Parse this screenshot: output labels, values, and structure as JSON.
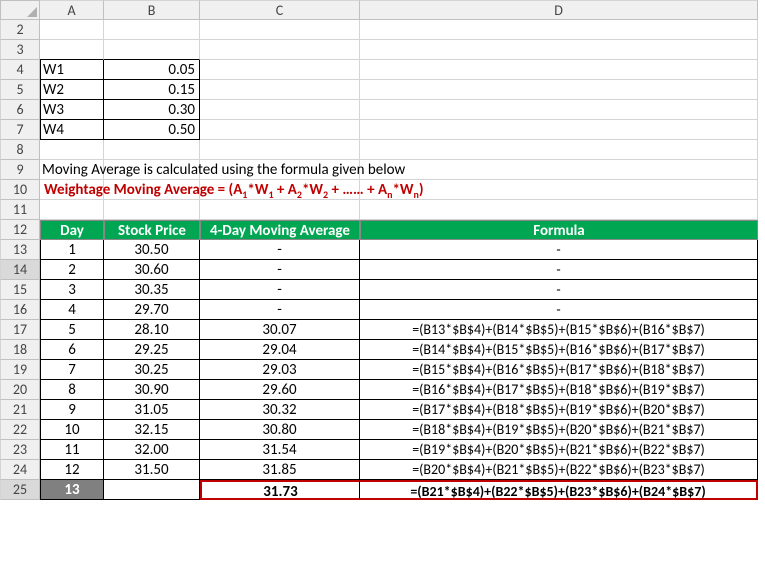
{
  "columns": [
    "",
    "A",
    "B",
    "C",
    "D"
  ],
  "weights": {
    "r4": {
      "label": "W1",
      "val": "0.05"
    },
    "r5": {
      "label": "W2",
      "val": "0.15"
    },
    "r6": {
      "label": "W3",
      "val": "0.30"
    },
    "r7": {
      "label": "W4",
      "val": "0.50"
    }
  },
  "desc_line": "Moving Average is calculated using the formula given below",
  "formula_label_pre": "Weightage Moving Average = (A",
  "formula_label": "Weightage Moving Average = (A₁*W₁ + A₂*W₂ + …… + Aₙ*Wₙ)",
  "headers": {
    "day": "Day",
    "price": "Stock Price",
    "ma": "4-Day Moving Average",
    "formula": "Formula"
  },
  "rows": [
    {
      "rn": "13",
      "day": "1",
      "price": "30.50",
      "ma": "-",
      "formula": "-"
    },
    {
      "rn": "14",
      "day": "2",
      "price": "30.60",
      "ma": "-",
      "formula": "-"
    },
    {
      "rn": "15",
      "day": "3",
      "price": "30.35",
      "ma": "-",
      "formula": "-"
    },
    {
      "rn": "16",
      "day": "4",
      "price": "29.70",
      "ma": "-",
      "formula": "-"
    },
    {
      "rn": "17",
      "day": "5",
      "price": "28.10",
      "ma": "30.07",
      "formula": "=(B13*$B$4)+(B14*$B$5)+(B15*$B$6)+(B16*$B$7)"
    },
    {
      "rn": "18",
      "day": "6",
      "price": "29.25",
      "ma": "29.04",
      "formula": "=(B14*$B$4)+(B15*$B$5)+(B16*$B$6)+(B17*$B$7)"
    },
    {
      "rn": "19",
      "day": "7",
      "price": "30.25",
      "ma": "29.03",
      "formula": "=(B15*$B$4)+(B16*$B$5)+(B17*$B$6)+(B18*$B$7)"
    },
    {
      "rn": "20",
      "day": "8",
      "price": "30.90",
      "ma": "29.60",
      "formula": "=(B16*$B$4)+(B17*$B$5)+(B18*$B$6)+(B19*$B$7)"
    },
    {
      "rn": "21",
      "day": "9",
      "price": "31.05",
      "ma": "30.32",
      "formula": "=(B17*$B$4)+(B18*$B$5)+(B19*$B$6)+(B20*$B$7)"
    },
    {
      "rn": "22",
      "day": "10",
      "price": "32.15",
      "ma": "30.80",
      "formula": "=(B18*$B$4)+(B19*$B$5)+(B20*$B$6)+(B21*$B$7)"
    },
    {
      "rn": "23",
      "day": "11",
      "price": "32.00",
      "ma": "31.54",
      "formula": "=(B19*$B$4)+(B20*$B$5)+(B21*$B$6)+(B22*$B$7)"
    },
    {
      "rn": "24",
      "day": "12",
      "price": "31.50",
      "ma": "31.85",
      "formula": "=(B20*$B$4)+(B21*$B$5)+(B22*$B$6)+(B23*$B$7)"
    }
  ],
  "last": {
    "rn": "25",
    "day": "13",
    "price": "",
    "ma": "31.73",
    "formula": "=(B21*$B$4)+(B22*$B$5)+(B23*$B$6)+(B24*$B$7)"
  },
  "rowheads": {
    "r2": "2",
    "r3": "3",
    "r4": "4",
    "r5": "5",
    "r6": "6",
    "r7": "7",
    "r8": "8",
    "r9": "9",
    "r10": "10",
    "r11": "11",
    "r12": "12"
  }
}
